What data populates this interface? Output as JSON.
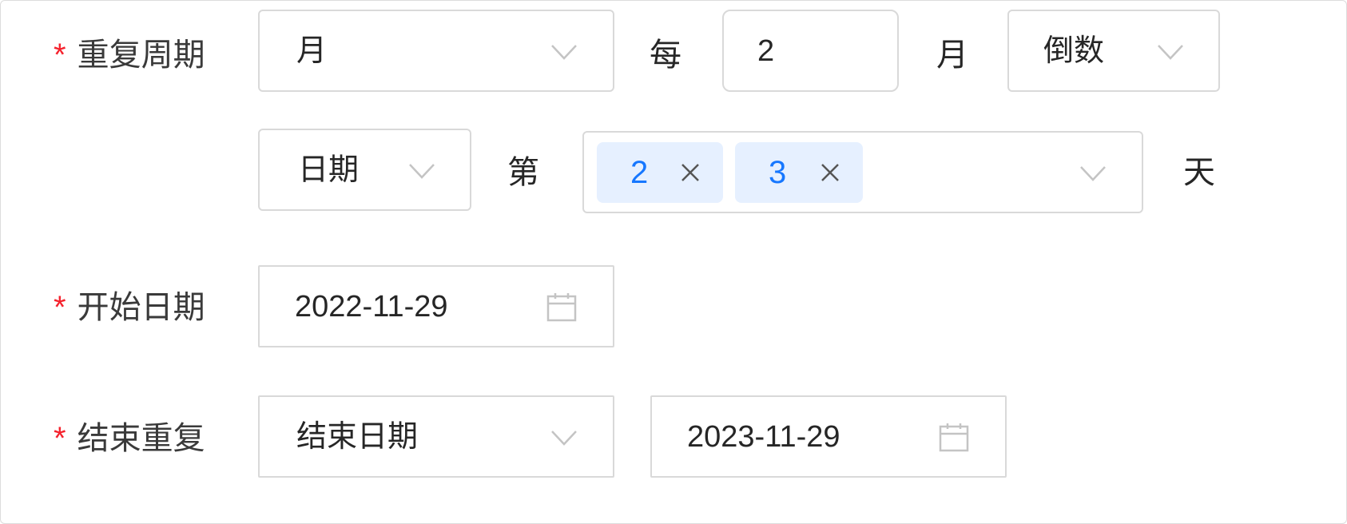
{
  "form": {
    "required_mark": "*",
    "repeat_cycle": {
      "label": "重复周期",
      "unit_select": "月",
      "every_prefix": "每",
      "interval_value": "2",
      "interval_unit": "月",
      "order_select": "倒数",
      "mode_select": "日期",
      "nth_prefix": "第",
      "selected_days": [
        "2",
        "3"
      ],
      "day_suffix": "天"
    },
    "start_date": {
      "label": "开始日期",
      "value": "2022-11-29"
    },
    "end_repeat": {
      "label": "结束重复",
      "type_select": "结束日期",
      "end_date_value": "2023-11-29"
    }
  },
  "icons": {
    "dropdown": "chevron-down-icon",
    "remove_tag": "close-icon",
    "date_picker": "calendar-icon"
  },
  "colors": {
    "required": "#f5222d",
    "tag_background": "#e6f0ff",
    "tag_text": "#1677ff",
    "border": "#d9d9d9",
    "icon": "#c4c4c4"
  }
}
